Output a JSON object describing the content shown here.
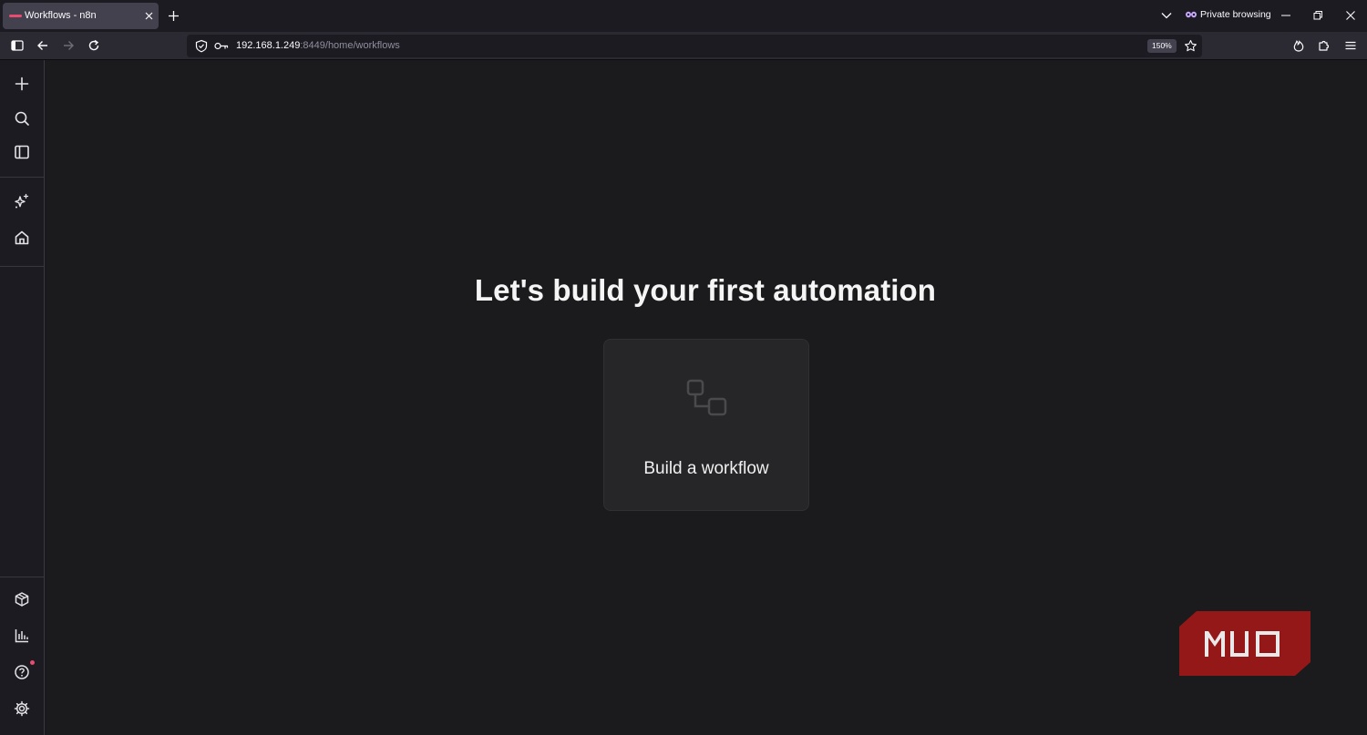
{
  "browser": {
    "tab": {
      "title": "Workflows - n8n"
    },
    "private_label": "Private browsing",
    "url": {
      "host": "192.168.1.249",
      "path": ":8449/home/workflows"
    },
    "zoom": "150%"
  },
  "main": {
    "headline": "Let's build your first automation",
    "card": {
      "label": "Build a workflow"
    }
  },
  "watermark": {
    "text": "MUO",
    "color": "#b71c1c"
  },
  "colors": {
    "accent": "#ea4b71",
    "background": "#1b1a1d",
    "card": "#262528"
  }
}
